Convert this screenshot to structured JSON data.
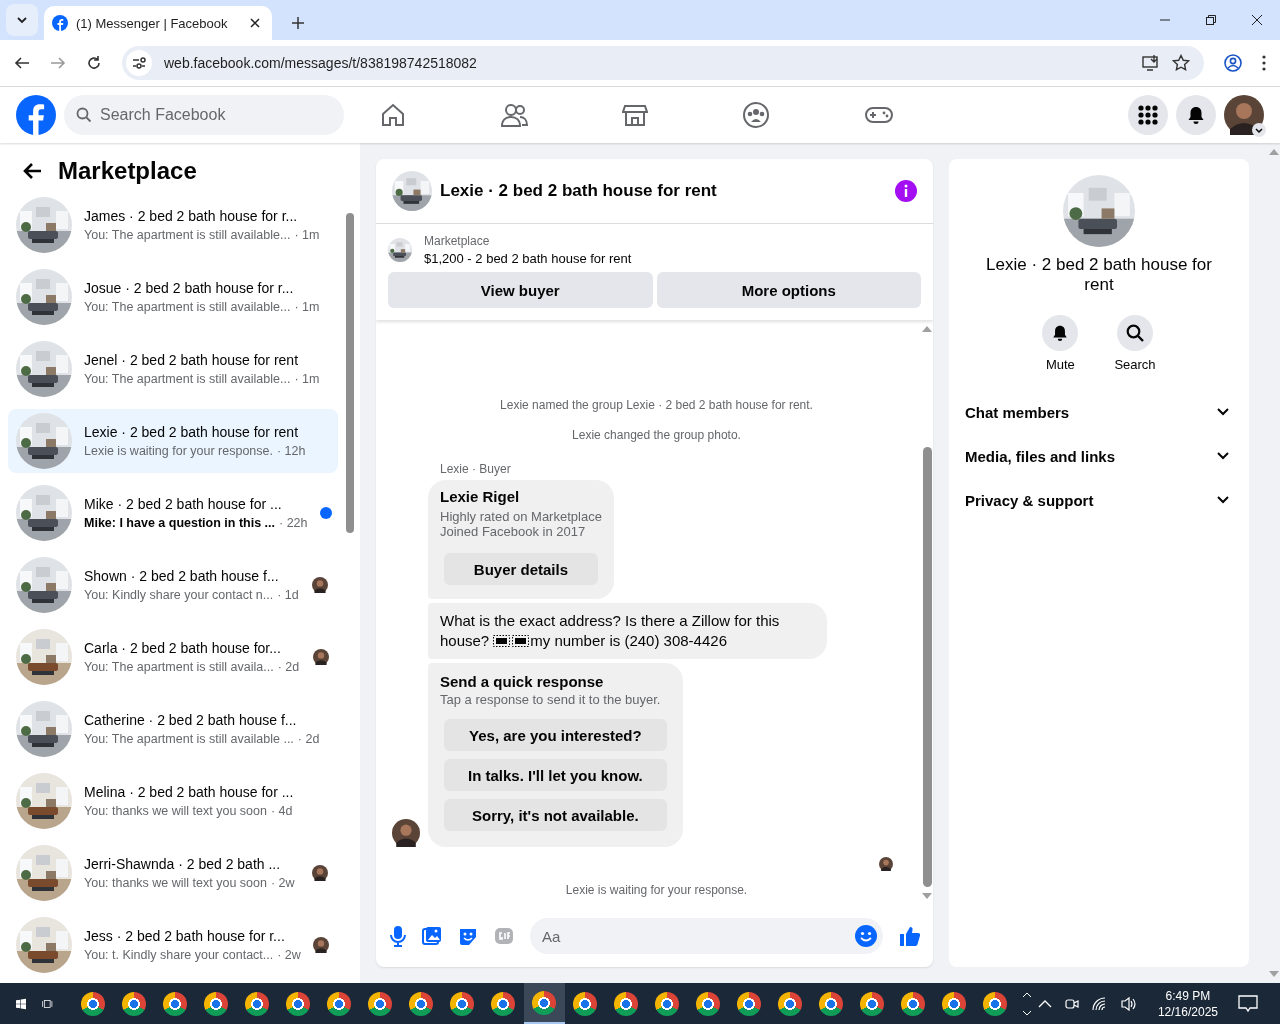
{
  "browser": {
    "tab_title": "(1) Messenger | Facebook",
    "url": "web.facebook.com/messages/t/838198742518082"
  },
  "header": {
    "search": {
      "placeholder": "Search Facebook"
    }
  },
  "sidebar": {
    "title": "Marketplace",
    "conversations": [
      {
        "title": "James · 2 bed 2 bath house for r...",
        "preview": "You: The apartment is still available...",
        "time": "· 1m",
        "selected": false,
        "unread": false,
        "seen": false
      },
      {
        "title": "Josue · 2 bed 2 bath house for r...",
        "preview": "You: The apartment is still available...",
        "time": "· 1m",
        "selected": false,
        "unread": false,
        "seen": false
      },
      {
        "title": "Jenel · 2 bed 2 bath house for rent",
        "preview": "You: The apartment is still available...",
        "time": "· 1m",
        "selected": false,
        "unread": false,
        "seen": false
      },
      {
        "title": "Lexie · 2 bed 2 bath house for rent",
        "preview": "Lexie is waiting for your response.",
        "time": "· 12h",
        "selected": true,
        "unread": false,
        "seen": false
      },
      {
        "title": "Mike · 2 bed 2 bath house for ...",
        "preview": "Mike: I have a question in this ...",
        "time": "· 22h",
        "selected": false,
        "unread": true,
        "seen": false
      },
      {
        "title": "Shown · 2 bed 2 bath house f...",
        "preview": "You: Kindly share your contact n...",
        "time": "· 1d",
        "selected": false,
        "unread": false,
        "seen": true
      },
      {
        "title": "Carla · 2 bed 2 bath house for...",
        "preview": "You: The apartment is still availa...",
        "time": "· 2d",
        "selected": false,
        "unread": false,
        "seen": true
      },
      {
        "title": "Catherine · 2 bed 2 bath house f...",
        "preview": "You: The apartment is still available ...",
        "time": "· 2d",
        "selected": false,
        "unread": false,
        "seen": false
      },
      {
        "title": "Melina · 2 bed 2 bath house for ...",
        "preview": "You: thanks we will text you soon",
        "time": "· 4d",
        "selected": false,
        "unread": false,
        "seen": false
      },
      {
        "title": "Jerri-Shawnda · 2 bed 2 bath ...",
        "preview": "You: thanks we will text you soon",
        "time": "· 2w",
        "selected": false,
        "unread": false,
        "seen": true
      },
      {
        "title": "Jess · 2 bed 2 bath house for r...",
        "preview": "You: t. Kindly share your contact...",
        "time": "· 2w",
        "selected": false,
        "unread": false,
        "seen": true
      }
    ]
  },
  "chat": {
    "title": "Lexie · 2 bed 2 bath house for rent",
    "listing": {
      "label": "Marketplace",
      "title": "$1,200 - 2 bed 2 bath house for rent",
      "buttons": [
        "View buyer",
        "More options"
      ]
    },
    "events": [
      "Lexie named the group Lexie · 2 bed 2 bath house for rent.",
      "Lexie changed the group photo."
    ],
    "sender": "Lexie · Buyer",
    "profile": {
      "name": "Lexie Rigel",
      "lines": [
        "Highly rated on Marketplace",
        "Joined Facebook in 2017"
      ],
      "button": "Buyer details"
    },
    "message": {
      "first_line": "What is the exact address? Is there a Zillow for this",
      "before_icons": "house?",
      "after_icons": "my number is (240) 308-4426"
    },
    "quick_response": {
      "title": "Send a quick response",
      "subtitle": "Tap a response to send it to the buyer.",
      "options": [
        "Yes, are you interested?",
        "In talks. I'll let you know.",
        "Sorry, it's not available."
      ]
    },
    "status": "Lexie is waiting for your response.",
    "composer": {
      "placeholder": "Aa"
    }
  },
  "details": {
    "title": "Lexie · 2 bed 2 bath house for rent",
    "actions": [
      {
        "kind": "mute",
        "label": "Mute"
      },
      {
        "kind": "search",
        "label": "Search"
      }
    ],
    "sections": [
      {
        "label": "Chat members",
        "expanded": false
      },
      {
        "label": "Media, files and links",
        "expanded": false
      },
      {
        "label": "Privacy & support",
        "expanded": false
      }
    ]
  },
  "taskbar": {
    "time": "6:49 PM",
    "date": "12/16/2025"
  }
}
